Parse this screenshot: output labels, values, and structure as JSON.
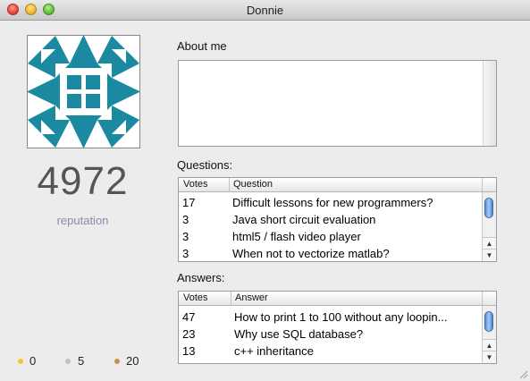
{
  "window": {
    "title": "Donnie"
  },
  "profile": {
    "reputation": "4972",
    "reputation_label": "reputation",
    "badges": [
      {
        "color": "#f6c42d",
        "count": "0"
      },
      {
        "color": "#c0c0c0",
        "count": "5"
      },
      {
        "color": "#c8915a",
        "count": "20"
      }
    ]
  },
  "about": {
    "label": "About me",
    "text": ""
  },
  "questions": {
    "label": "Questions:",
    "columns": [
      "Votes",
      "Question"
    ],
    "rows": [
      {
        "votes": "17",
        "title": "Difficult lessons for new programmers?"
      },
      {
        "votes": "3",
        "title": "Java short circuit evaluation"
      },
      {
        "votes": "3",
        "title": "html5 / flash video player"
      },
      {
        "votes": "3",
        "title": "When not to vectorize matlab?"
      }
    ]
  },
  "answers": {
    "label": "Answers:",
    "columns": [
      "Votes",
      "Answer"
    ],
    "rows": [
      {
        "votes": "47",
        "title": "How to print 1 to 100 without any loopin..."
      },
      {
        "votes": "23",
        "title": "Why use SQL database?"
      },
      {
        "votes": "13",
        "title": "c++ inheritance"
      }
    ]
  }
}
